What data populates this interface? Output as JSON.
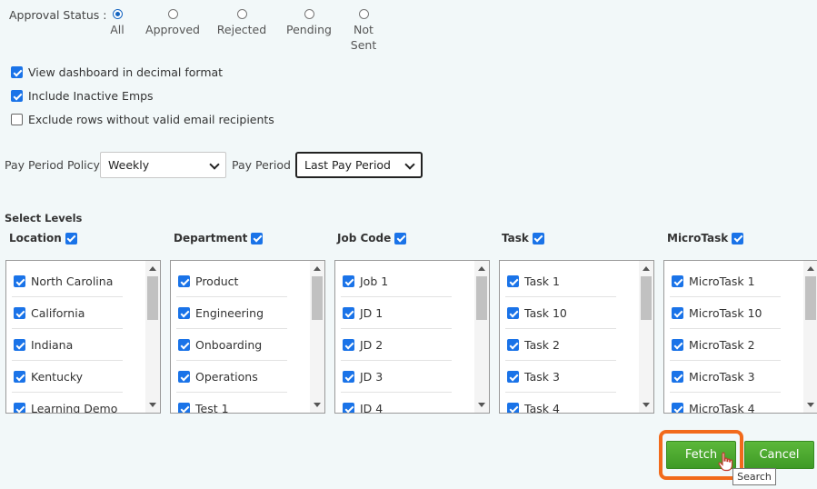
{
  "approval": {
    "label": "Approval Status :",
    "options": [
      {
        "lines": [
          "All"
        ],
        "checked": true
      },
      {
        "lines": [
          "Approved"
        ],
        "checked": false
      },
      {
        "lines": [
          "Rejected"
        ],
        "checked": false
      },
      {
        "lines": [
          "Pending"
        ],
        "checked": false
      },
      {
        "lines": [
          "Not",
          "Sent"
        ],
        "checked": false
      }
    ]
  },
  "options": [
    {
      "label": "View dashboard in decimal format",
      "checked": true
    },
    {
      "label": "Include Inactive Emps",
      "checked": true
    },
    {
      "label": "Exclude rows without valid email recipients",
      "checked": false
    }
  ],
  "pay_period": {
    "policy_label": "Pay Period Policy",
    "policy_value": "Weekly",
    "period_label": "Pay Period",
    "period_value": "Last Pay Period"
  },
  "levels": {
    "title": "Select Levels",
    "columns": [
      {
        "name": "Location",
        "checked": true,
        "items": [
          "North Carolina",
          "California",
          "Indiana",
          "Kentucky",
          "Learning Demo"
        ]
      },
      {
        "name": "Department",
        "checked": true,
        "items": [
          "Product",
          "Engineering",
          "Onboarding",
          "Operations",
          "Test 1"
        ]
      },
      {
        "name": "Job Code",
        "checked": true,
        "items": [
          "Job 1",
          "JD 1",
          "JD 2",
          "JD 3",
          "JD 4"
        ]
      },
      {
        "name": "Task",
        "checked": true,
        "items": [
          "Task 1",
          "Task 10",
          "Task 2",
          "Task 3",
          "Task 4"
        ]
      },
      {
        "name": "MicroTask",
        "checked": true,
        "items": [
          "MicroTask 1",
          "MicroTask 10",
          "MicroTask 2",
          "MicroTask 3",
          "MicroTask 4"
        ]
      }
    ]
  },
  "buttons": {
    "fetch": "Fetch",
    "cancel": "Cancel",
    "tooltip": "Search"
  },
  "colors": {
    "accent": "#1a73e8",
    "button_green": "#4aa630",
    "highlight": "#f26a1b"
  },
  "icons": {
    "cursor": "hand-pointer-icon",
    "dropdown": "chevron-down-icon"
  }
}
